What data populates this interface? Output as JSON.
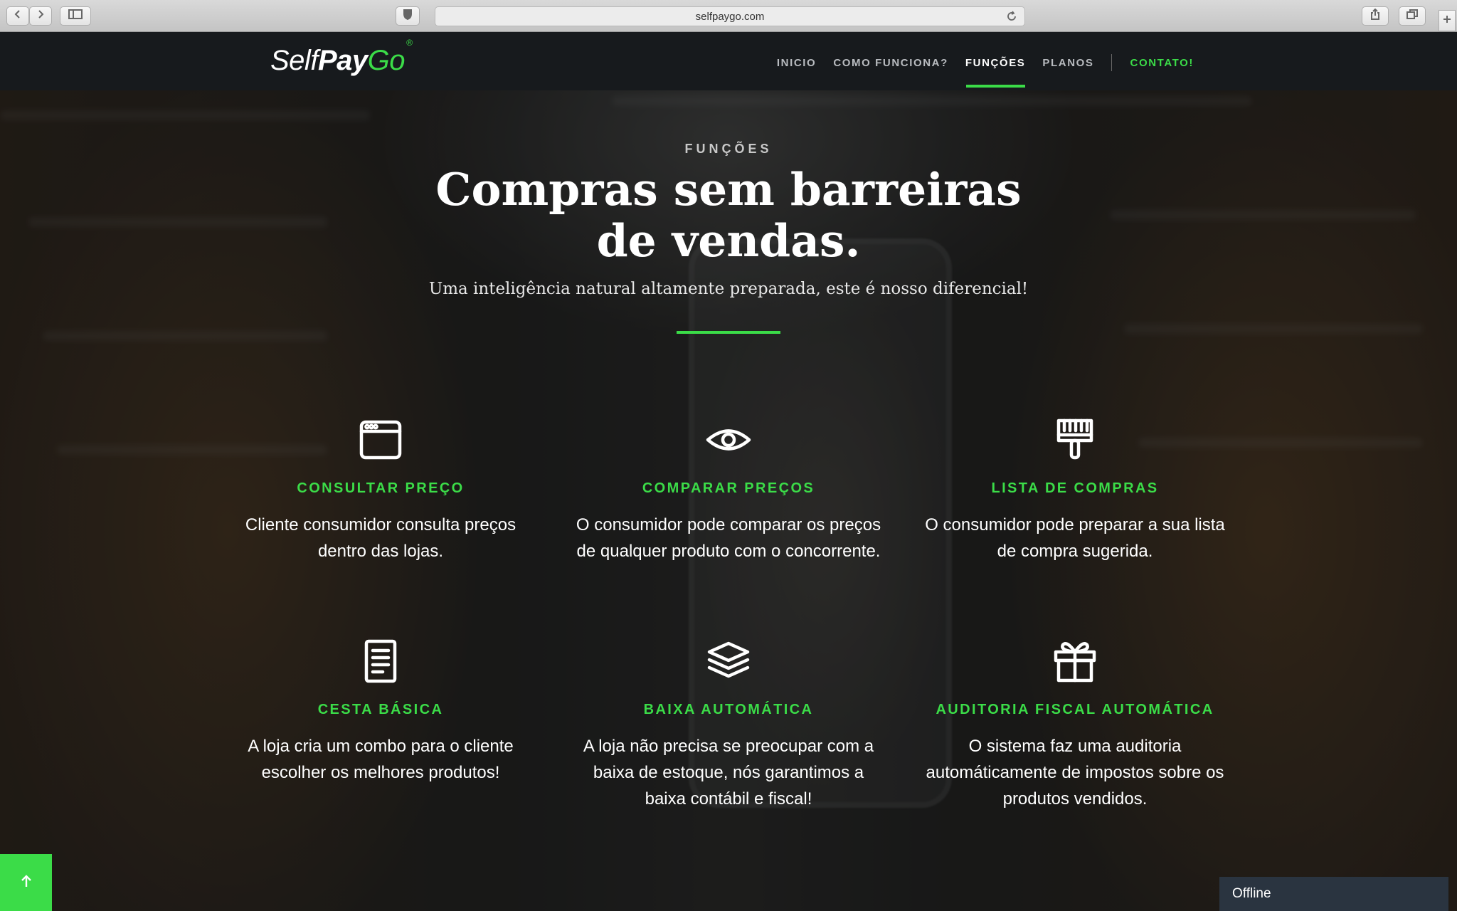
{
  "browser": {
    "url": "selfpaygo.com",
    "icons": [
      "back-icon",
      "forward-icon",
      "sidebar-icon",
      "shield-icon",
      "reload-icon",
      "share-icon",
      "tabs-icon",
      "new-tab-icon"
    ]
  },
  "brand": {
    "logo_self": "Self",
    "logo_pay": "Pay",
    "logo_go": "Go",
    "logo_mark": "®",
    "accent_color": "#3bdc48"
  },
  "nav": {
    "items": [
      {
        "label": "INICIO"
      },
      {
        "label": "COMO FUNCIONA?"
      },
      {
        "label": "FUNÇÕES",
        "active": true
      },
      {
        "label": "PLANOS"
      }
    ],
    "contact": "CONTATO!"
  },
  "hero": {
    "eyebrow": "FUNÇÕES",
    "headline": "Compras sem barreiras de vendas.",
    "subtitle": "Uma inteligência natural altamente preparada, este é nosso diferencial!"
  },
  "features": [
    {
      "icon": "browser-window-icon",
      "title": "CONSULTAR PREÇO",
      "desc": "Cliente consumidor consulta preços dentro das lojas."
    },
    {
      "icon": "eye-icon",
      "title": "COMPARAR PREÇOS",
      "desc": "O consumidor pode comparar os preços de qualquer produto com o concorrente."
    },
    {
      "icon": "paint-brush-icon",
      "title": "LISTA DE COMPRAS",
      "desc": "O consumidor pode preparar a sua lista de compra sugerida."
    },
    {
      "icon": "document-icon",
      "title": "CESTA BÁSICA",
      "desc": "A loja cria um combo para o cliente escolher os melhores produtos!"
    },
    {
      "icon": "layers-icon",
      "title": "BAIXA AUTOMÁTICA",
      "desc": "A loja não precisa se preocupar com a baixa de estoque, nós garantimos a baixa contábil e fiscal!"
    },
    {
      "icon": "gift-icon",
      "title": "AUDITORIA FISCAL AUTOMÁTICA",
      "desc": "O sistema faz uma auditoria automáticamente de impostos sobre os produtos vendidos."
    }
  ],
  "widgets": {
    "scroll_top_icon": "arrow-up-icon",
    "chat_status": "Offline"
  }
}
